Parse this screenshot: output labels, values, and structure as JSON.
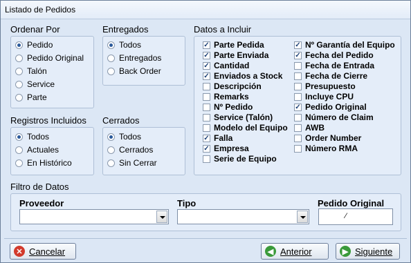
{
  "window": {
    "title": "Listado de Pedidos"
  },
  "ordenar": {
    "label": "Ordenar Por",
    "options": [
      "Pedido",
      "Pedido Original",
      "Talón",
      "Service",
      "Parte"
    ],
    "selected": 0
  },
  "entregados": {
    "label": "Entregados",
    "options": [
      "Todos",
      "Entregados",
      "Back Order"
    ],
    "selected": 0
  },
  "registros": {
    "label": "Registros Incluidos",
    "options": [
      "Todos",
      "Actuales",
      "En Histórico"
    ],
    "selected": 0
  },
  "cerrados": {
    "label": "Cerrados",
    "options": [
      "Todos",
      "Cerrados",
      "Sin Cerrar"
    ],
    "selected": 0
  },
  "datos": {
    "label": "Datos a Incluir",
    "col1": [
      {
        "label": "Parte Pedida",
        "checked": true
      },
      {
        "label": "Parte Enviada",
        "checked": true
      },
      {
        "label": "Cantidad",
        "checked": true
      },
      {
        "label": "Enviados a Stock",
        "checked": true
      },
      {
        "label": "Descripción",
        "checked": false
      },
      {
        "label": "Remarks",
        "checked": false
      },
      {
        "label": "Nº Pedido",
        "checked": false
      },
      {
        "label": "Service (Talón)",
        "checked": false
      },
      {
        "label": "Modelo del Equipo",
        "checked": false
      },
      {
        "label": "Falla",
        "checked": true
      },
      {
        "label": "Empresa",
        "checked": true
      },
      {
        "label": "Serie de Equipo",
        "checked": false
      }
    ],
    "col2": [
      {
        "label": "Nº Garantía del Equipo",
        "checked": true
      },
      {
        "label": "Fecha del Pedido",
        "checked": true
      },
      {
        "label": "Fecha de Entrada",
        "checked": false
      },
      {
        "label": "Fecha de Cierre",
        "checked": false
      },
      {
        "label": "Presupuesto",
        "checked": false
      },
      {
        "label": "Incluye CPU",
        "checked": false
      },
      {
        "label": "Pedido Original",
        "checked": true
      },
      {
        "label": "Número de Claim",
        "checked": false
      },
      {
        "label": "AWB",
        "checked": false
      },
      {
        "label": "Order Number",
        "checked": false
      },
      {
        "label": "Número RMA",
        "checked": false
      }
    ]
  },
  "filtro": {
    "label": "Filtro de Datos",
    "proveedor": {
      "label": "Proveedor",
      "value": ""
    },
    "tipo": {
      "label": "Tipo",
      "value": ""
    },
    "pedido_original": {
      "label": "Pedido Original",
      "value": ""
    }
  },
  "buttons": {
    "cancelar": "Cancelar",
    "anterior": "Anterior",
    "siguiente": "Siguiente"
  },
  "colors": {
    "cancel": "#d23a2c",
    "nav": "#3a9a3a"
  }
}
